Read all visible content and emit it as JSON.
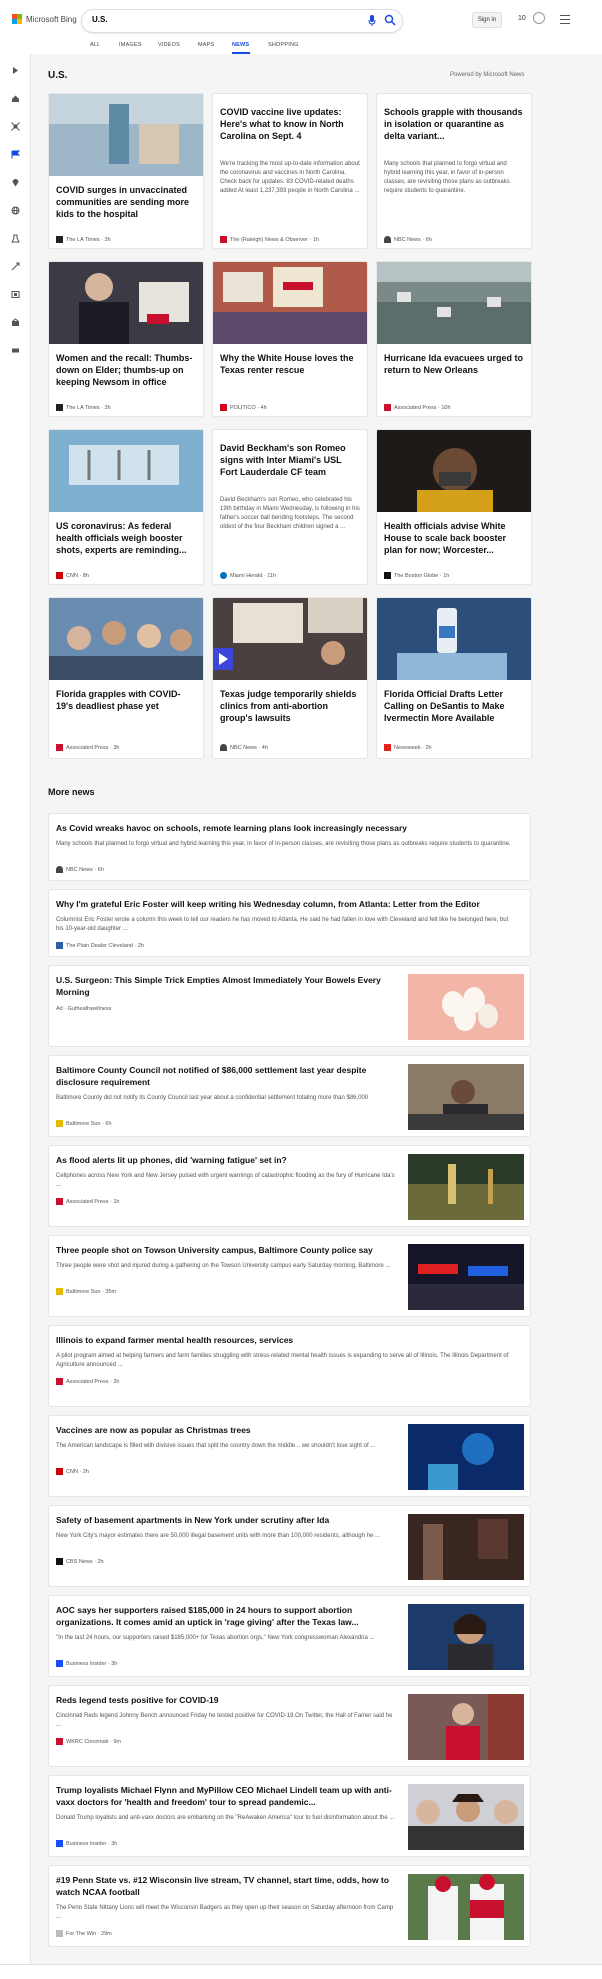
{
  "header": {
    "logo_text": "Microsoft Bing",
    "search_value": "U.S.",
    "signin_label": "Sign in",
    "points": "10"
  },
  "tabs": [
    "ALL",
    "IMAGES",
    "VIDEOS",
    "MAPS",
    "NEWS",
    "SHOPPING"
  ],
  "active_tab": "NEWS",
  "section_title": "U.S.",
  "powered_by": "Powered by Microsoft News",
  "cards": [
    {
      "title": "COVID surges in unvaccinated communities are sending more kids to the hospital",
      "snippet": "",
      "source": "The LA Times · 3h",
      "has_image": true
    },
    {
      "title": "COVID vaccine live updates: Here's what to know in North Carolina on Sept. 4",
      "snippet": "We're tracking the most up-to-date information about the coronavirus and vaccines in North Carolina. Check back for updates. 83 COVID-related deaths added At least 1,237,393 people in North Carolina ...",
      "source": "The (Raleigh) News & Observer · 1h",
      "has_image": false
    },
    {
      "title": "Schools grapple with thousands in isolation or quarantine as delta variant...",
      "snippet": "Many schools that planned to forgo virtual and hybrid learning this year, in favor of in-person classes, are revisiting those plans as outbreaks require students to quarantine.",
      "source": "NBC News · 6h",
      "has_image": false
    },
    {
      "title": "Women and the recall: Thumbs-down on Elder; thumbs-up on keeping Newsom in office",
      "snippet": "",
      "source": "The LA Times · 3h",
      "has_image": true
    },
    {
      "title": "Why the White House loves the Texas renter rescue",
      "snippet": "",
      "source": "POLITICO · 4h",
      "has_image": true
    },
    {
      "title": "Hurricane Ida evacuees urged to return to New Orleans",
      "snippet": "",
      "source": "Associated Press · 10h",
      "has_image": true
    },
    {
      "title": "US coronavirus: As federal health officials weigh booster shots, experts are reminding...",
      "snippet": "",
      "source": "CNN · 8h",
      "has_image": true
    },
    {
      "title": "David Beckham's son Romeo signs with Inter Miami's USL Fort Lauderdale CF team",
      "snippet": "David Beckham's son Romeo, who celebrated his 19th birthday in Miami Wednesday, is following in his father's soccer ball bending footsteps. The second oldest of the four Beckham children signed a ...",
      "source": "Miami Herald · 11h",
      "has_image": false
    },
    {
      "title": "Health officials advise White House to scale back booster plan for now; Worcester...",
      "snippet": "",
      "source": "The Boston Globe · 1h",
      "has_image": true
    },
    {
      "title": "Florida grapples with COVID-19's deadliest phase yet",
      "snippet": "",
      "source": "Associated Press · 3h",
      "has_image": true
    },
    {
      "title": "Texas judge temporarily shields clinics from anti-abortion group's lawsuits",
      "snippet": "",
      "source": "NBC News · 4h",
      "has_image": true
    },
    {
      "title": "Florida Official Drafts Letter Calling on DeSantis to Make Ivermectin More Available",
      "snippet": "",
      "source": "Newsweek · 2h",
      "has_image": true
    }
  ],
  "more_news_title": "More news",
  "rows": [
    {
      "title": "As Covid wreaks havoc on schools, remote learning plans look increasingly necessary",
      "snippet": "Many schools that planned to forgo virtual and hybrid learning this year, in favor of in-person classes, are revisiting those plans as outbreaks require students to quarantine.",
      "source": "NBC News · 6h"
    },
    {
      "title": "Why I'm grateful Eric Foster will keep writing his Wednesday column, from Atlanta: Letter from the Editor",
      "snippet": "Columnist Eric Foster wrote a column this week to tell our readers he has moved to Atlanta. He said he had fallen in love with Cleveland and felt like he belonged here, but his 10-year-old daughter ...",
      "source": "The Plain Dealer Cleveland · 2h"
    },
    {
      "title": "U.S. Surgeon: This Simple Trick Empties Almost Immediately Your Bowels Every Morning",
      "snippet": "",
      "source": "Ad · Gutheathwellness"
    },
    {
      "title": "Baltimore County Council not notified of $86,000 settlement last year despite disclosure requirement",
      "snippet": "Baltimore County did not notify its County Council last year about a confidential settlement totaling more than $86,000",
      "source": "Baltimore Sun · 6h"
    },
    {
      "title": "As flood alerts lit up phones, did 'warning fatigue' set in?",
      "snippet": "Cellphones across New York and New Jersey pulsed with urgent warnings of catastrophic flooding as the fury of Hurricane Ida's ...",
      "source": "Associated Press · 1h"
    },
    {
      "title": "Three people shot on Towson University campus, Baltimore County police say",
      "snippet": "Three people were shot and injured during a gathering on the Towson University campus early Saturday morning, Baltimore ...",
      "source": "Baltimore Sun · 35m"
    },
    {
      "title": "Illinois to expand farmer mental health resources, services",
      "snippet": "A pilot program aimed at helping farmers and farm families struggling with stress-related mental health issues is expanding to serve all of Illinois. The Illinois Department of Agriculture announced ...",
      "source": "Associated Press · 2h"
    },
    {
      "title": "Vaccines are now as popular as Christmas trees",
      "snippet": "The American landscape is filled with divisive issues that split the country down the middle... we shouldn't lose sight of ...",
      "source": "CNN · 2h"
    },
    {
      "title": "Safety of basement apartments in New York under scrutiny after Ida",
      "snippet": "New York City's mayor estimates there are 50,000 illegal basement units with more than 100,000 residents, although he ...",
      "source": "CBS News · 2h"
    },
    {
      "title": "AOC says her supporters raised $185,000 in 24 hours to support abortion organizations. It comes amid an uptick in 'rage giving' after the Texas law...",
      "snippet": "\"In the last 24 hours, our supporters raised $185,000+ for Texas abortion orgs,\" New York congresswoman Alexandria ...",
      "source": "Business Insider · 3h"
    },
    {
      "title": "Reds legend tests positive for COVID-19",
      "snippet": "Cincinnati Reds legend Johnny Bench announced Friday he tested positive for COVID-19.On Twitter, the Hall of Famer said he ...",
      "source": "WKRC Cincinnati · 9m"
    },
    {
      "title": "Trump loyalists Michael Flynn and MyPillow CEO Michael Lindell team up with anti-vaxx doctors for 'health and freedom' tour to spread pandemic...",
      "snippet": "Donald Trump loyalists and anti-vaxx doctors are embarking on the \"ReAwaken America\" tour to fuel disinformation about the ...",
      "source": "Business Insider · 3h"
    },
    {
      "title": "#19 Penn State vs. #12 Wisconsin live stream, TV channel, start time, odds, how to watch NCAA football",
      "snippet": "The Penn State Nittany Lions will meet the Wisconsin Badgers as they open up their season on Saturday afternoon from Camp ...",
      "source": "For The Win · 29m"
    }
  ],
  "colors": {
    "accent": "#174ae4",
    "page_bg": "#f5f5f5"
  }
}
